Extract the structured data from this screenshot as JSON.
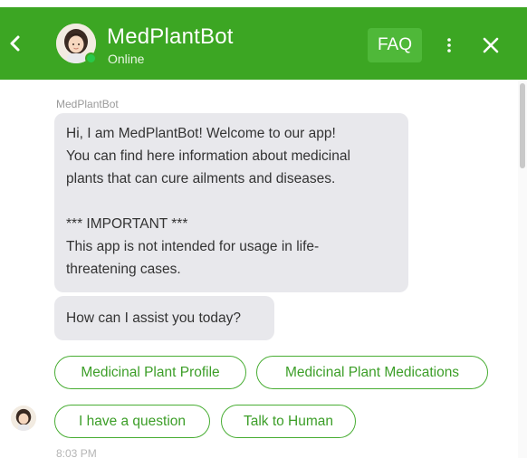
{
  "header": {
    "bot_name": "MedPlantBot",
    "status": "Online",
    "faq_label": "FAQ",
    "icons": [
      "chevron-left-icon",
      "bot-avatar",
      "more-vertical-icon",
      "close-icon"
    ],
    "brand_color": "#3ca623"
  },
  "chat": {
    "sender": "MedPlantBot",
    "message_1_lines": [
      "Hi, I am MedPlantBot! Welcome to our app!",
      "You can find here information about medicinal",
      "plants that can cure ailments and diseases.",
      "*** IMPORTANT ***",
      "This app is not intended for usage in life-",
      "threatening cases."
    ],
    "message_2": "How can I assist you today?",
    "quick_replies": [
      "Medicinal Plant Profile",
      "Medicinal Plant Medications",
      "I have a question",
      "Talk to Human"
    ],
    "timestamp": "8:03 PM"
  }
}
